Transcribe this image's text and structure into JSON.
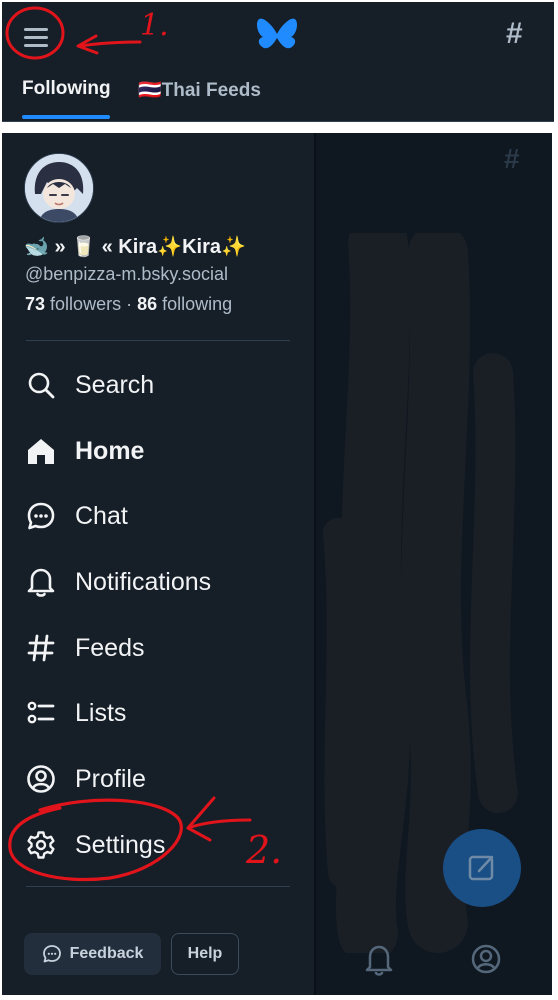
{
  "top_bar": {
    "tabs": [
      {
        "label": "Following",
        "active": true
      },
      {
        "label": "🇹🇭Thai Feeds",
        "active": false
      }
    ],
    "menu_icon": "hamburger-icon",
    "logo_icon": "butterfly-logo",
    "feeds_icon": "hash-icon"
  },
  "drawer": {
    "profile": {
      "display_name": "🐋 » 🥛 « Kira✨Kira✨",
      "handle": "@benpizza-m.bsky.social",
      "followers_count": "73",
      "followers_label": "followers",
      "separator": "·",
      "following_count": "86",
      "following_label": "following"
    },
    "nav_items": [
      {
        "label": "Search",
        "icon": "search-icon"
      },
      {
        "label": "Home",
        "icon": "home-icon",
        "active": true
      },
      {
        "label": "Chat",
        "icon": "chat-icon"
      },
      {
        "label": "Notifications",
        "icon": "bell-icon"
      },
      {
        "label": "Feeds",
        "icon": "hash-icon"
      },
      {
        "label": "Lists",
        "icon": "list-icon"
      },
      {
        "label": "Profile",
        "icon": "person-icon"
      },
      {
        "label": "Settings",
        "icon": "gear-icon"
      }
    ],
    "feedback_label": "Feedback",
    "help_label": "Help"
  },
  "annotations": {
    "step1": "1.",
    "step2": "2."
  },
  "colors": {
    "accent": "#208bfe",
    "background": "#161e27",
    "annotation": "#e0141a"
  }
}
